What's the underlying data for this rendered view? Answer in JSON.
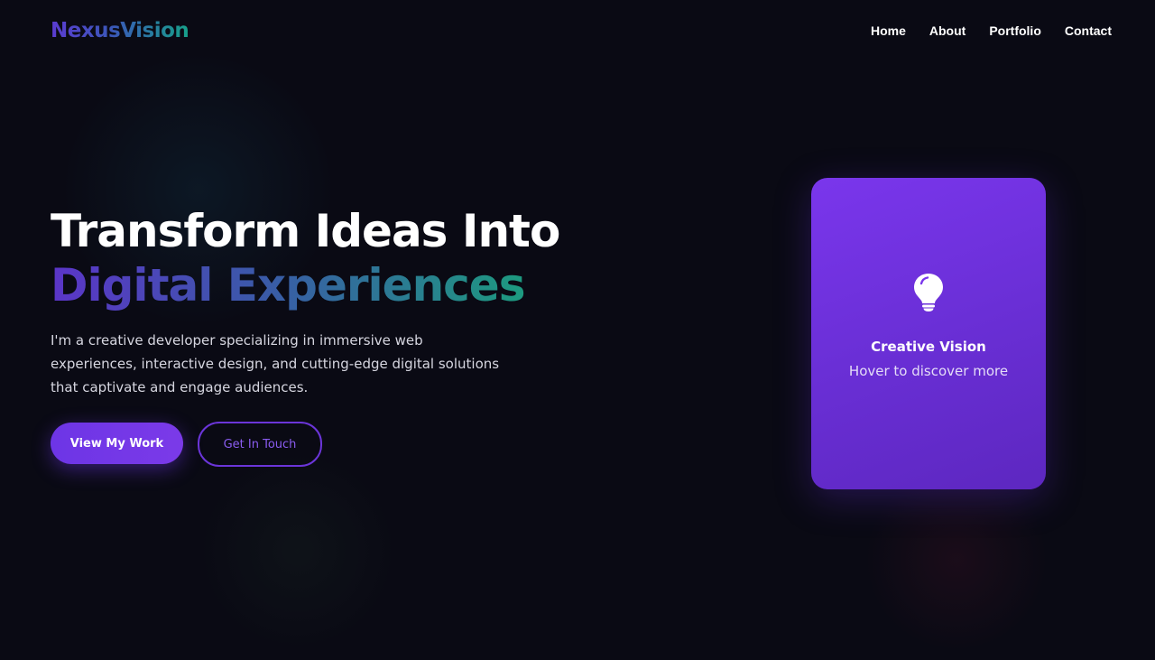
{
  "brand": {
    "name": "NexusVision"
  },
  "nav": {
    "items": [
      {
        "label": "Home"
      },
      {
        "label": "About"
      },
      {
        "label": "Portfolio"
      },
      {
        "label": "Contact"
      }
    ]
  },
  "hero": {
    "title_line1": "Transform Ideas Into",
    "title_line2": "Digital Experiences",
    "description": "I'm a creative developer specializing in immersive web experiences, interactive design, and cutting-edge digital solutions that captivate and engage audiences.",
    "primary_button": "View My Work",
    "secondary_button": "Get In Touch"
  },
  "card": {
    "icon": "lightbulb-icon",
    "title": "Creative Vision",
    "subtitle": "Hover to discover more"
  },
  "colors": {
    "background": "#0a0a14",
    "accent_purple": "#6d35e6",
    "gradient_teal": "#1d9a7f",
    "card": "#7a36ec",
    "text_primary": "#ffffff",
    "text_muted": "#d6d6e0"
  }
}
